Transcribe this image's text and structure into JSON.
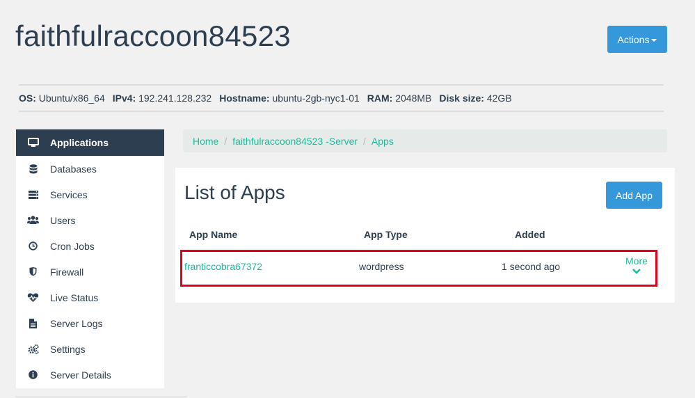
{
  "header": {
    "title": "faithfulraccoon84523",
    "actions_label": "Actions"
  },
  "server_info": [
    {
      "key": "OS:",
      "value": "Ubuntu/x86_64"
    },
    {
      "key": "IPv4:",
      "value": "192.241.128.232"
    },
    {
      "key": "Hostname:",
      "value": "ubuntu-2gb-nyc1-01"
    },
    {
      "key": "RAM:",
      "value": "2048MB"
    },
    {
      "key": "Disk size:",
      "value": "42GB"
    }
  ],
  "sidebar": {
    "items": [
      {
        "label": "Applications",
        "icon": "monitor-icon"
      },
      {
        "label": "Databases",
        "icon": "database-icon"
      },
      {
        "label": "Services",
        "icon": "server-icon"
      },
      {
        "label": "Users",
        "icon": "users-icon"
      },
      {
        "label": "Cron Jobs",
        "icon": "clock-icon"
      },
      {
        "label": "Firewall",
        "icon": "shield-icon"
      },
      {
        "label": "Live Status",
        "icon": "heartbeat-icon"
      },
      {
        "label": "Server Logs",
        "icon": "file-icon"
      },
      {
        "label": "Settings",
        "icon": "gears-icon"
      },
      {
        "label": "Server Details",
        "icon": "info-icon"
      }
    ]
  },
  "breadcrumb": {
    "home": "Home",
    "server": "faithfulraccoon84523 -Server",
    "apps": "Apps"
  },
  "apps_panel": {
    "title": "List of Apps",
    "add_label": "Add App",
    "columns": {
      "name": "App Name",
      "type": "App Type",
      "added": "Added"
    },
    "rows": [
      {
        "name": "franticcobra67372",
        "type": "wordpress",
        "added": "1 second ago",
        "more": "More"
      }
    ]
  },
  "colors": {
    "accent": "#18bc9c",
    "primary": "#3498db",
    "dark": "#2c3e50",
    "highlight": "#e0001a"
  }
}
